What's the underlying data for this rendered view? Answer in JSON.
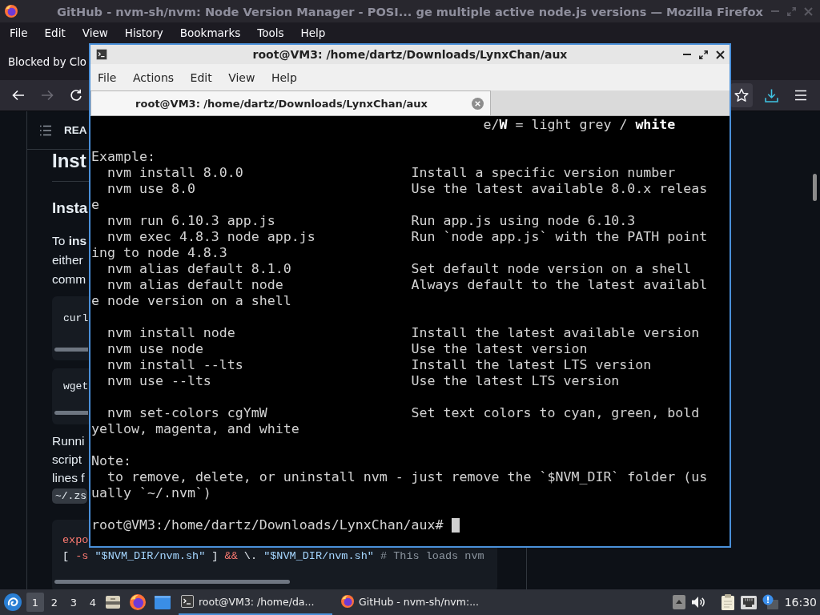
{
  "browser": {
    "title": "GitHub - nvm-sh/nvm: Node Version Manager - POSI... ge multiple active node.js versions — Mozilla Firefox",
    "menu": [
      "File",
      "Edit",
      "View",
      "History",
      "Bookmarks",
      "Tools",
      "Help"
    ],
    "notification": "Blocked by Clo",
    "nav_buttons": [
      {
        "kind": "back",
        "disabled": false
      },
      {
        "kind": "forward",
        "disabled": true
      },
      {
        "kind": "reload",
        "disabled": false
      }
    ],
    "toolbar_buttons": [
      {
        "kind": "bookmark",
        "highlighted": true
      },
      {
        "kind": "downloads",
        "highlighted": false
      },
      {
        "kind": "menu",
        "highlighted": false
      }
    ]
  },
  "page": {
    "header_label": "REA",
    "heading_1": "Inst",
    "heading_2": "Insta",
    "paragraph_1": [
      "To **ins**",
      "either",
      "comm"
    ],
    "code_block_1": {
      "lines": [
        [
          {
            "kind": "plain",
            "text": "curl"
          }
        ]
      ]
    },
    "code_block_2": {
      "lines": [
        [
          {
            "kind": "plain",
            "text": "wget"
          }
        ]
      ]
    },
    "paragraph_2": {
      "lines": [
        "Runni",
        "script",
        "lines f"
      ],
      "inline_code": "~/.zs"
    },
    "code_block_3": {
      "lines": [
        [
          {
            "kind": "keyword",
            "text": "expo"
          }
        ],
        [
          {
            "kind": "plain",
            "text": "[ "
          },
          {
            "kind": "keyword",
            "text": "-s"
          },
          {
            "kind": "string",
            "text": " \"$NVM_DIR/nvm.sh\""
          },
          {
            "kind": "plain",
            "text": " ] "
          },
          {
            "kind": "keyword",
            "text": "&&"
          },
          {
            "kind": "plain",
            "text": " \\. "
          },
          {
            "kind": "string",
            "text": "\"$NVM_DIR/nvm.sh\" "
          },
          {
            "kind": "comment",
            "text": "# This loads nvm"
          }
        ]
      ]
    }
  },
  "terminal": {
    "title": "root@VM3: /home/dartz/Downloads/LynxChan/aux",
    "menu": [
      "File",
      "Actions",
      "Edit",
      "View",
      "Help"
    ],
    "tabs": [
      {
        "label": "root@VM3: /home/dartz/Downloads/LynxChan/aux",
        "selected": true
      }
    ],
    "output": [
      [
        "                                                 e/**W** = light grey / **white**"
      ],
      [
        "Example:",
        "  nvm install 8.0.0                     Install a specific version number",
        "  nvm use 8.0                           Use the latest available 8.0.x releas",
        "e",
        "  nvm run 6.10.3 app.js                 Run app.js using node 6.10.3",
        "  nvm exec 4.8.3 node app.js            Run `node app.js` with the PATH point",
        "ing to node 4.8.3",
        "  nvm alias default 8.1.0               Set default node version on a shell",
        "  nvm alias default node                Always default to the latest availabl",
        "e node version on a shell"
      ],
      [
        "  nvm install node                      Install the latest available version",
        "  nvm use node                          Use the latest version",
        "  nvm install --lts                     Install the latest LTS version",
        "  nvm use --lts                         Use the latest LTS version"
      ],
      [
        "  nvm set-colors cgYmW                  Set text colors to cyan, green, bold",
        "yellow, magenta, and white"
      ],
      [
        "Note:",
        "  to remove, delete, or uninstall nvm - just remove the `$NVM_DIR` folder (us",
        "ually `~/.nvm`)"
      ]
    ],
    "prompt": "root@VM3:/home/dartz/Downloads/LynxChan/aux#"
  },
  "taskbar": {
    "workspaces": [
      {
        "label": "1",
        "selected": true
      },
      {
        "label": "2",
        "selected": false
      },
      {
        "label": "3",
        "selected": false
      },
      {
        "label": "4",
        "selected": false
      }
    ],
    "launchers": [
      {
        "kind": "files"
      },
      {
        "kind": "browser"
      },
      {
        "kind": "desktop"
      }
    ],
    "tasks": [
      {
        "kind": "terminal",
        "label": "root@VM3: /home/da...",
        "selected": true
      },
      {
        "kind": "browser",
        "label": "GitHub - nvm-sh/nvm:...",
        "selected": false
      }
    ],
    "tray": [
      {
        "kind": "expand"
      },
      {
        "kind": "volume"
      },
      {
        "kind": "clipboard"
      },
      {
        "kind": "network"
      },
      {
        "kind": "notifications"
      }
    ],
    "clock": "16:30"
  }
}
